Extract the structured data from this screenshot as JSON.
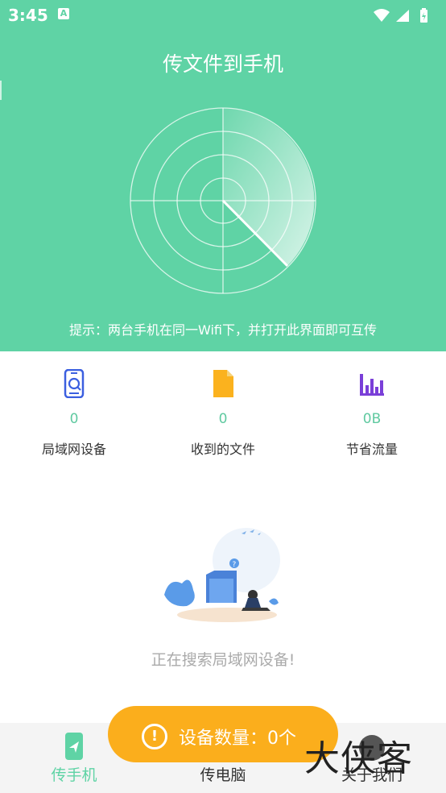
{
  "status_bar": {
    "time": "3:45",
    "notification_glyph": "A",
    "icons": [
      "wifi-icon",
      "signal-icon",
      "battery-icon"
    ]
  },
  "header": {
    "title": "传文件到手机",
    "hint": "提示：两台手机在同一Wifi下，并打开此界面即可互传",
    "background": "#5fd3a5"
  },
  "stats": [
    {
      "icon": "phone-search-icon",
      "value": "0",
      "label": "局域网设备",
      "color": "#3b5fe0"
    },
    {
      "icon": "file-icon",
      "value": "0",
      "label": "收到的文件",
      "color": "#fbb21e"
    },
    {
      "icon": "bar-chart-icon",
      "value": "0B",
      "label": "节省流量",
      "color": "#7a3fd8"
    }
  ],
  "search_status": "正在搜索局域网设备!",
  "toast": {
    "text": "设备数量：0个",
    "color": "#fbae1c"
  },
  "bottom_nav": [
    {
      "label": "传手机",
      "icon": "send-phone-icon",
      "active": true
    },
    {
      "label": "传电脑",
      "icon": "computer-icon",
      "active": false
    },
    {
      "label": "关于我们",
      "icon": "info-icon",
      "active": false
    }
  ],
  "watermark": "大侠客"
}
